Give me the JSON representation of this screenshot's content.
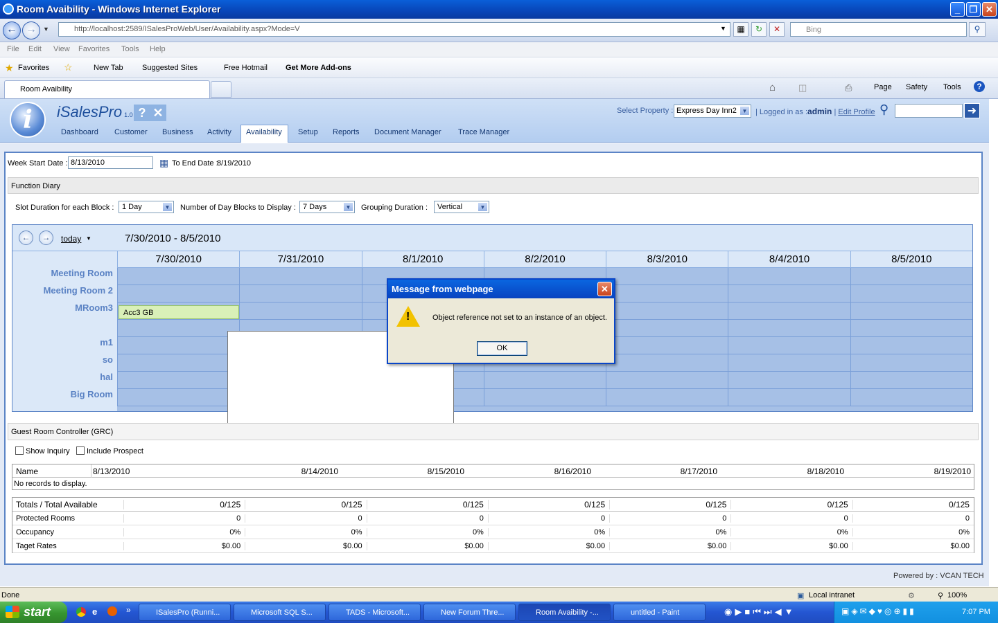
{
  "window": {
    "title": "Room Avaibility - Windows Internet Explorer"
  },
  "address": {
    "url": "http://localhost:2589/ISalesProWeb/User/Availability.aspx?Mode=V",
    "search_placeholder": "Bing"
  },
  "menu": [
    "File",
    "Edit",
    "View",
    "Favorites",
    "Tools",
    "Help"
  ],
  "favorites": {
    "label": "Favorites",
    "items": [
      "New Tab",
      "Suggested Sites",
      "Free Hotmail",
      "Get More Add-ons"
    ]
  },
  "tab": {
    "label": "Room Avaibility"
  },
  "commands": [
    "Page",
    "Safety",
    "Tools"
  ],
  "app": {
    "brand": "iSalesPro",
    "version": "1.0",
    "nav": [
      "Dashboard",
      "Customer",
      "Business",
      "Activity",
      "Availability",
      "Setup",
      "Reports",
      "Document Manager",
      "Trace Manager"
    ],
    "select_property_label": "Select Property :",
    "property": "Express Day Inn2",
    "logged_in_label": "Logged in as :",
    "user": "admin",
    "edit_profile": "Edit Profile"
  },
  "filters": {
    "week_start_label": "Week Start Date :",
    "week_start_value": "8/13/2010",
    "to_end_label": "To End Date :",
    "to_end_value": "8/19/2010"
  },
  "function_diary": {
    "title": "Function Diary",
    "slot_label": "Slot Duration for each Block :",
    "slot_value": "1 Day",
    "blocks_label": "Number of Day Blocks to Display :",
    "blocks_value": "7 Days",
    "grouping_label": "Grouping Duration :",
    "grouping_value": "Vertical",
    "today": "today",
    "range": "7/30/2010 - 8/5/2010",
    "days": [
      "7/30/2010",
      "7/31/2010",
      "8/1/2010",
      "8/2/2010",
      "8/3/2010",
      "8/4/2010",
      "8/5/2010"
    ],
    "rooms": [
      "Meeting Room",
      "Meeting Room 2",
      "MRoom3",
      "m1",
      "so",
      "hal",
      "Big Room"
    ],
    "event": "Acc3 GB"
  },
  "grc": {
    "title": "Guest Room Controller (GRC)",
    "show_inquiry": "Show Inquiry",
    "include_prospect": "Include Prospect",
    "headers": [
      "Name",
      "8/13/2010",
      "8/14/2010",
      "8/15/2010",
      "8/16/2010",
      "8/17/2010",
      "8/18/2010",
      "8/19/2010"
    ],
    "empty": "No records to display.",
    "totals": {
      "rows": [
        {
          "label": "Totals / Total Available",
          "values": [
            "0/125",
            "0/125",
            "0/125",
            "0/125",
            "0/125",
            "0/125",
            "0/125"
          ]
        },
        {
          "label": "Protected Rooms",
          "values": [
            "0",
            "0",
            "0",
            "0",
            "0",
            "0",
            "0"
          ]
        },
        {
          "label": "Occupancy",
          "values": [
            "0%",
            "0%",
            "0%",
            "0%",
            "0%",
            "0%",
            "0%"
          ]
        },
        {
          "label": "Taget Rates",
          "values": [
            "$0.00",
            "$0.00",
            "$0.00",
            "$0.00",
            "$0.00",
            "$0.00",
            "$0.00"
          ]
        }
      ]
    }
  },
  "footer": {
    "powered": "Powered by : VCAN TECH"
  },
  "dialog": {
    "title": "Message from webpage",
    "message": "Object reference not set to an instance of an object.",
    "ok": "OK"
  },
  "status": {
    "left": "Done",
    "zone": "Local intranet",
    "zoom": "100%"
  },
  "taskbar": {
    "start": "start",
    "buttons": [
      "ISalesPro (Runni...",
      "Microsoft SQL S...",
      "TADS - Microsoft...",
      "New Forum Thre...",
      "Room Avaibility -...",
      "untitled - Paint"
    ],
    "clock": "7:07 PM"
  }
}
